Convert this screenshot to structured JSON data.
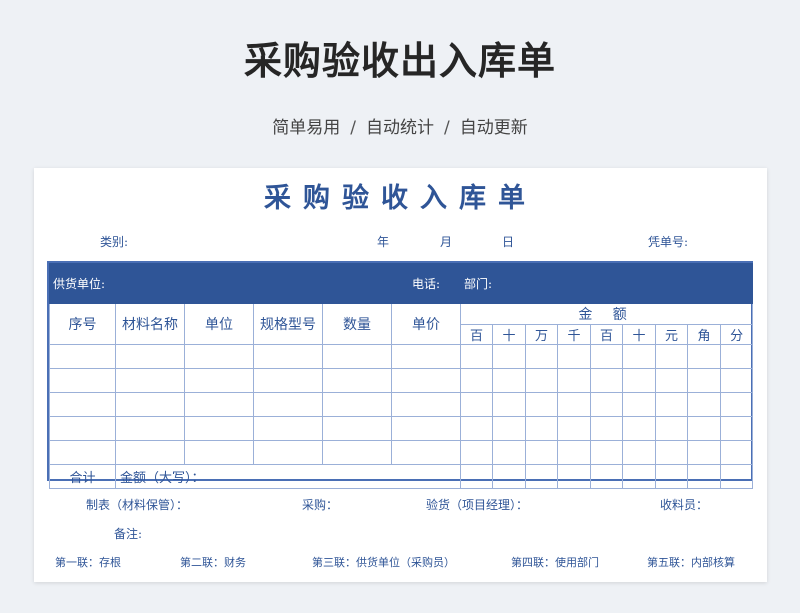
{
  "banner": {
    "title": "采购验收出入库单",
    "tags": [
      "简单易用",
      "自动统计",
      "自动更新"
    ],
    "separator": "/"
  },
  "form": {
    "title": "采购验收入库单",
    "meta": {
      "category": "类别:",
      "year": "年",
      "month": "月",
      "day": "日",
      "voucher_no": "凭单号:"
    },
    "supplier_bar": {
      "supplier": "供货单位:",
      "phone": "电话:",
      "department": "部门:"
    },
    "columns": [
      "序号",
      "材料名称",
      "单位",
      "规格型号",
      "数量",
      "单价"
    ],
    "amount_header": "金 额",
    "digits": [
      "百",
      "十",
      "万",
      "千",
      "百",
      "十",
      "元",
      "角",
      "分"
    ],
    "total_label": "合计",
    "total_text": "金额（大写）：",
    "signatures": {
      "maker": "制表（材料保管）：",
      "purchase": "采购：",
      "inspector": "验货（项目经理）：",
      "receiver": "收料员："
    },
    "remark": "备注:",
    "copies": [
      "第一联：存根",
      "第二联：财务",
      "第三联：供货单位（采购员）",
      "第四联：使用部门",
      "第五联：内部核算"
    ]
  }
}
